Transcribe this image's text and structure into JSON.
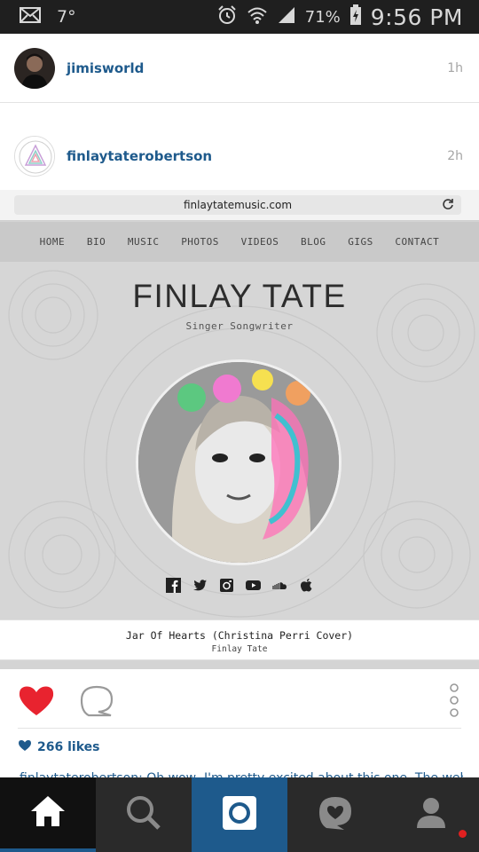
{
  "status_bar": {
    "temperature": "7°",
    "battery_percent": "71%",
    "time": "9:56 PM"
  },
  "posts": [
    {
      "username": "jimisworld",
      "time_ago": "1h"
    },
    {
      "username": "finlaytaterobertson",
      "time_ago": "2h"
    }
  ],
  "embedded_site": {
    "url": "finlaytatemusic.com",
    "nav": [
      "HOME",
      "BIO",
      "MUSIC",
      "PHOTOS",
      "VIDEOS",
      "BLOG",
      "GIGS",
      "CONTACT"
    ],
    "title": "FINLAY TATE",
    "subtitle": "Singer Songwriter",
    "social_icons": [
      "facebook-icon",
      "twitter-icon",
      "instagram-icon",
      "youtube-icon",
      "soundcloud-icon",
      "apple-icon"
    ],
    "song_title": "Jar Of Hearts (Christina Perri Cover)",
    "song_artist": "Finlay Tate"
  },
  "actions": {
    "likes": "266 likes",
    "caption": "finlaytaterobertson: Oh wow, I'm pretty excited about this one. The website"
  },
  "bottom_nav": [
    "home-tab",
    "explore-tab",
    "camera-tab",
    "activity-tab",
    "profile-tab"
  ],
  "colors": {
    "accent": "#1e5a8c",
    "like": "#e8232f",
    "notification": "#e02020"
  }
}
